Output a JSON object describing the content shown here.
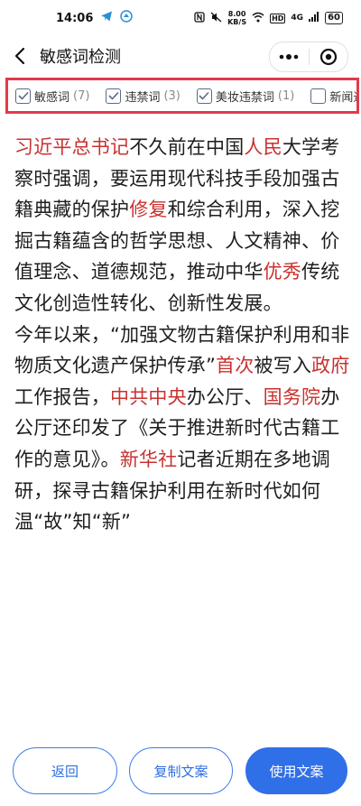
{
  "status_bar": {
    "time": "14:06",
    "net_speed": "8.00",
    "net_unit": "KB/S",
    "hd_label": "HD",
    "signal_label": "4G",
    "battery": "60"
  },
  "header": {
    "title": "敏感词检测"
  },
  "filters": [
    {
      "label": "敏感词",
      "count": "(7)",
      "checked": true
    },
    {
      "label": "违禁词",
      "count": "(3)",
      "checked": true
    },
    {
      "label": "美妆违禁词",
      "count": "(1)",
      "checked": true
    },
    {
      "label": "新闻违禁词",
      "count": "",
      "checked": false
    }
  ],
  "article": {
    "p1": [
      {
        "text": "习近平总书记",
        "highlight": true
      },
      {
        "text": "不久前在中国",
        "highlight": false
      },
      {
        "text": "人民",
        "highlight": true
      },
      {
        "text": "大学考察时强调，要运用现代科技手段加强古籍典藏的保护",
        "highlight": false
      },
      {
        "text": "修复",
        "highlight": true
      },
      {
        "text": "和综合利用，深入挖掘古籍蕴含的哲学思想、人文精神、价值理念、道德规范，推动中华",
        "highlight": false
      },
      {
        "text": "优秀",
        "highlight": true
      },
      {
        "text": "传统文化创造性转化、创新性发展。",
        "highlight": false
      }
    ],
    "p2": [
      {
        "text": "今年以来，“加强文物古籍保护利用和非物质文化遗产保护传承”",
        "highlight": false
      },
      {
        "text": "首次",
        "highlight": true
      },
      {
        "text": "被写入",
        "highlight": false
      },
      {
        "text": "政府",
        "highlight": true
      },
      {
        "text": "工作报告，",
        "highlight": false
      },
      {
        "text": "中共中央",
        "highlight": true
      },
      {
        "text": "办公厅、",
        "highlight": false
      },
      {
        "text": "国务院",
        "highlight": true
      },
      {
        "text": "办公厅还印发了《关于推进新时代古籍工作的意见》。",
        "highlight": false
      },
      {
        "text": "新华社",
        "highlight": true
      },
      {
        "text": "记者近期在多地调研，探寻古籍保护利用在新时代如何温“故”知“新”",
        "highlight": false
      }
    ]
  },
  "buttons": {
    "back": "返回",
    "copy": "复制文案",
    "use": "使用文案"
  },
  "colors": {
    "highlight": "#c8322f",
    "accent": "#2f6fe8",
    "frame": "#e23a4a"
  }
}
